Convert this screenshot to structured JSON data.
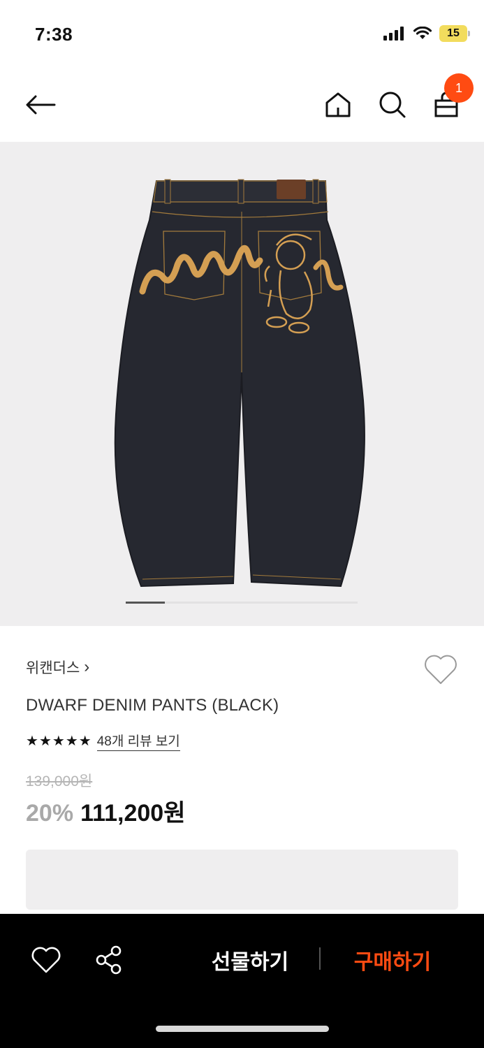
{
  "status_bar": {
    "time": "7:38",
    "battery": "15"
  },
  "header": {
    "cart_count": "1"
  },
  "product": {
    "brand": "위캔더스",
    "brand_chevron": "›",
    "name": "DWARF DENIM PANTS (BLACK)",
    "rating_stars": 5,
    "review_link": "48개 리뷰 보기",
    "original_price": "139,000원",
    "discount": "20%",
    "sale_price": "111,200원"
  },
  "gallery": {
    "image_icon": "denim-pants-photo",
    "current_page": 1
  },
  "bottom_bar": {
    "gift_label": "선물하기",
    "buy_label": "구매하기",
    "buy_color": "#ff4b12"
  },
  "icons": {
    "back": "back-arrow-icon",
    "home": "home-icon",
    "search": "search-icon",
    "cart": "shopping-bag-icon",
    "wish": "heart-icon",
    "share": "share-icon"
  }
}
